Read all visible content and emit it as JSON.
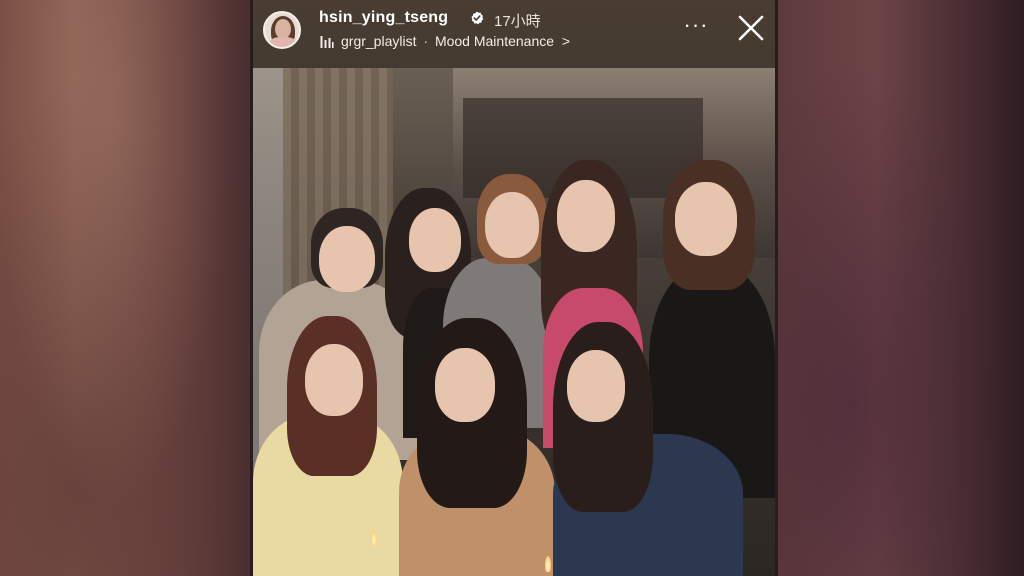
{
  "story": {
    "username": "hsin_ying_tseng",
    "time_ago": "17小時",
    "music": {
      "playlist": "grgr_playlist",
      "separator": "·",
      "track": "Mood Maintenance",
      "chevron": ">"
    },
    "more_label": "···",
    "icons": {
      "verified": "verified-badge-icon",
      "music": "music-bars-icon",
      "close": "close-icon",
      "more": "more-icon"
    }
  },
  "colors": {
    "verified_badge": "#ffffff",
    "header_bg": "#463b32",
    "text": "#ffffff"
  }
}
